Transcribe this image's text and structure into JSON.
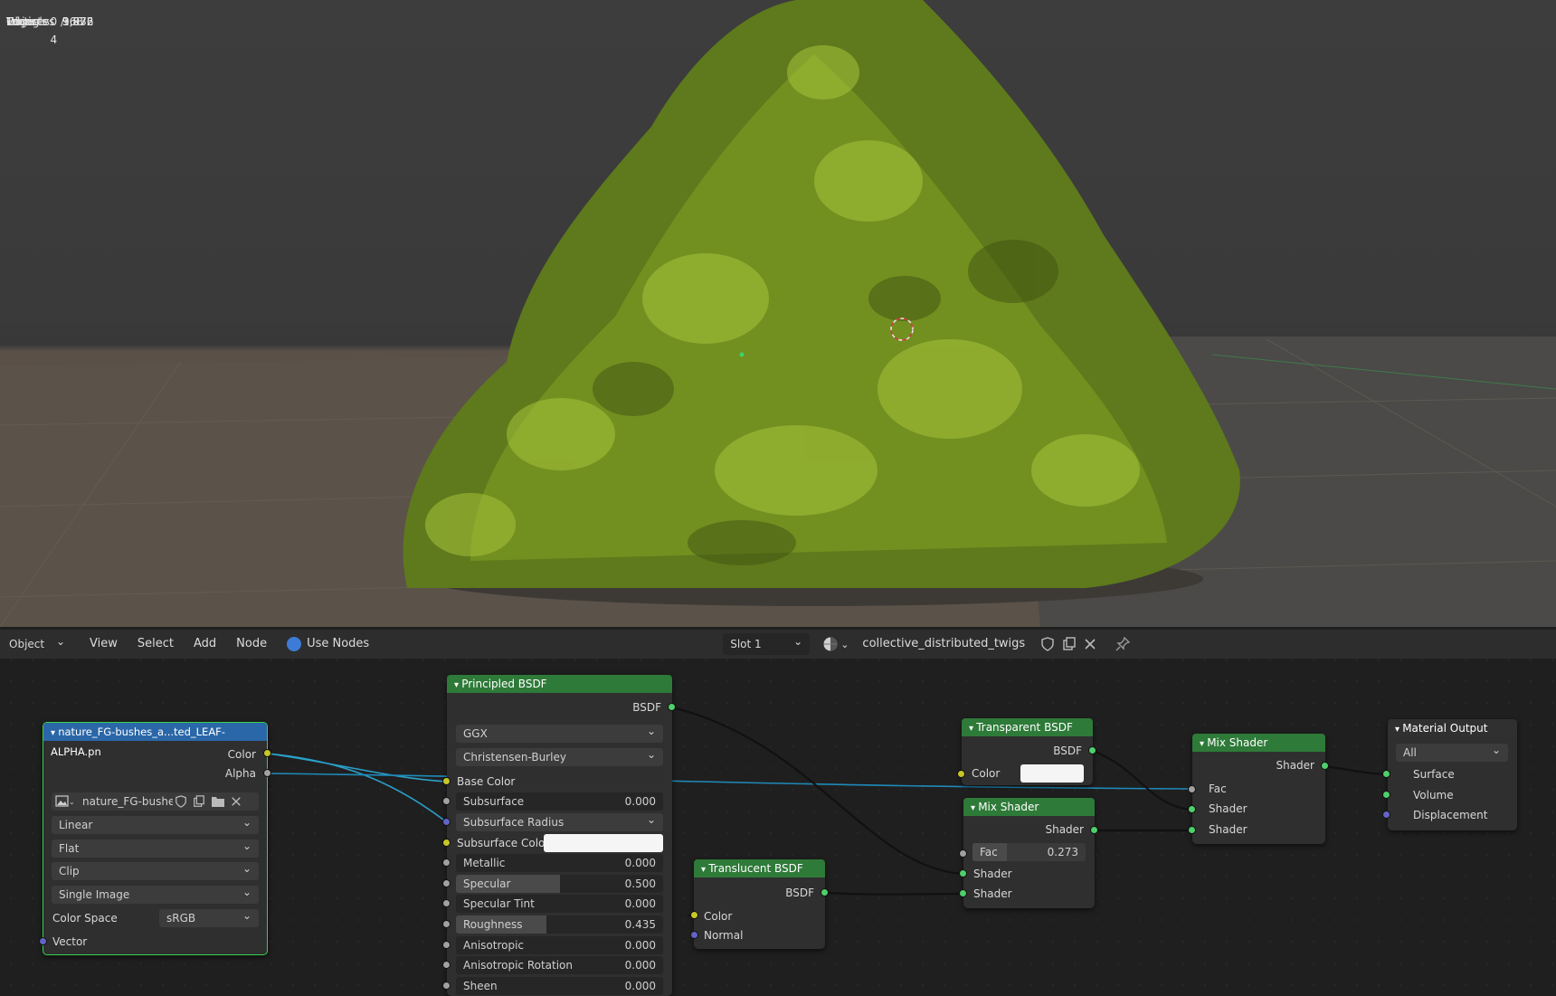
{
  "stats": [
    {
      "label": "Objects",
      "value": "0 / 4"
    },
    {
      "label": "Vertices",
      "value": "3,872"
    },
    {
      "label": "Edges",
      "value": "3,872"
    },
    {
      "label": "Faces",
      "value": "968"
    },
    {
      "label": "Triangles",
      "value": "1,936"
    }
  ],
  "header": {
    "mode": "Object",
    "menu": [
      "View",
      "Select",
      "Add",
      "Node"
    ],
    "use_nodes": "Use Nodes",
    "slot": "Slot 1",
    "material": "collective_distributed_twigs"
  },
  "image_node": {
    "title": "nature_FG-bushes_a...ted_LEAF-ALPHA.pn",
    "out_color": "Color",
    "out_alpha": "Alpha",
    "image_name": "nature_FG-bushes...",
    "interpolation": "Linear",
    "projection": "Flat",
    "extension": "Clip",
    "source": "Single Image",
    "color_space_label": "Color Space",
    "color_space": "sRGB",
    "in_vector": "Vector"
  },
  "principled": {
    "title": "Principled BSDF",
    "out": "BSDF",
    "distribution": "GGX",
    "sss_method": "Christensen-Burley",
    "base_color": "Base Color",
    "subsurface": {
      "label": "Subsurface",
      "value": "0.000",
      "fill": 0
    },
    "subsurface_radius": "Subsurface Radius",
    "subsurface_color": "Subsurface Color",
    "metallic": {
      "label": "Metallic",
      "value": "0.000",
      "fill": 0
    },
    "specular": {
      "label": "Specular",
      "value": "0.500",
      "fill": 0.5
    },
    "specular_tint": {
      "label": "Specular Tint",
      "value": "0.000",
      "fill": 0
    },
    "roughness": {
      "label": "Roughness",
      "value": "0.435",
      "fill": 0.435
    },
    "anisotropic": {
      "label": "Anisotropic",
      "value": "0.000",
      "fill": 0
    },
    "anisotropic_rotation": {
      "label": "Anisotropic Rotation",
      "value": "0.000",
      "fill": 0
    },
    "sheen": {
      "label": "Sheen",
      "value": "0.000",
      "fill": 0
    }
  },
  "translucent": {
    "title": "Translucent BSDF",
    "out": "BSDF",
    "in_color": "Color",
    "in_normal": "Normal"
  },
  "transparent": {
    "title": "Transparent BSDF",
    "out": "BSDF",
    "in_color": "Color"
  },
  "mix1": {
    "title": "Mix Shader",
    "out": "Shader",
    "fac_label": "Fac",
    "fac_value": "0.273",
    "in1": "Shader",
    "in2": "Shader"
  },
  "mix2": {
    "title": "Mix Shader",
    "out": "Shader",
    "fac": "Fac",
    "in1": "Shader",
    "in2": "Shader"
  },
  "output": {
    "title": "Material Output",
    "target": "All",
    "surface": "Surface",
    "volume": "Volume",
    "displacement": "Displacement"
  },
  "colors": {
    "node_green": "#2e7a38",
    "node_blue": "#2a67a8",
    "accent": "#3d7cd6"
  }
}
